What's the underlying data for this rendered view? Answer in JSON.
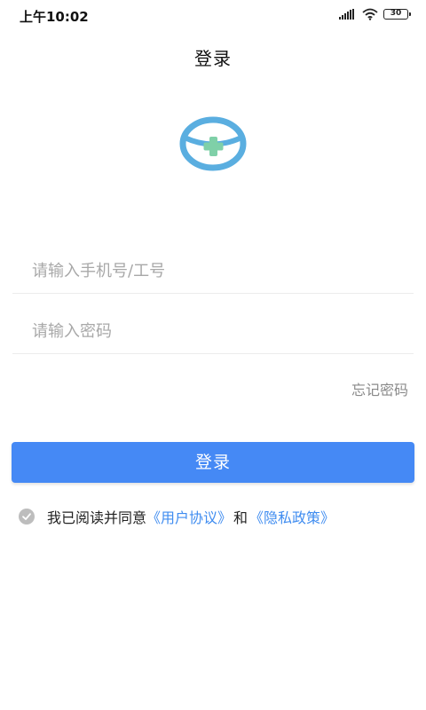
{
  "status_bar": {
    "time": "上午10:02",
    "battery": "30"
  },
  "header": {
    "title": "登录"
  },
  "form": {
    "phone_placeholder": "请输入手机号/工号",
    "password_placeholder": "请输入密码",
    "forgot_label": "忘记密码",
    "login_label": "登录"
  },
  "agreement": {
    "prefix": "我已阅读并同意",
    "user_agreement": "《用户协议》",
    "and_text": "和",
    "privacy_policy": "《隐私政策》",
    "checked": false
  },
  "colors": {
    "primary": "#4589f5",
    "link": "#3f8cf0",
    "logo_blue": "#5aaee0",
    "logo_green": "#7fd0a8"
  },
  "icons": [
    "signal-icon",
    "wifi-icon",
    "battery-icon",
    "app-logo-icon",
    "check-circle-icon"
  ]
}
